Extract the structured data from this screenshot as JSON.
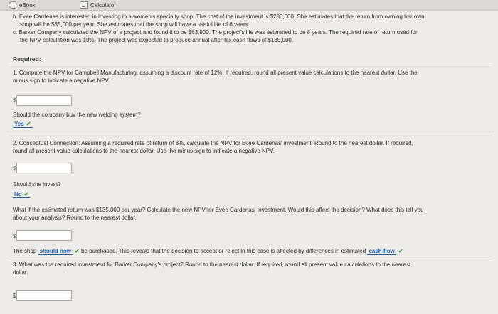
{
  "topbar": {
    "ebook_label": "eBook",
    "calculator_label": "Calculator"
  },
  "intro": {
    "b_line1": "b. Evee Cardenas is interested in investing in a women's specialty shop. The cost of the investment is $280,000. She estimates that the return from owning her own",
    "b_line2": "shop will be $35,000 per year. She estimates that the shop will have a useful life of 6 years.",
    "c_line1": "c. Barker Company calculated the NPV of a project and found it to be $63,900. The project's life was estimated to be 8 years. The required rate of return used for",
    "c_line2": "the NPV calculation was 10%. The project was expected to produce annual after-tax cash flows of $135,000."
  },
  "required": "Required:",
  "q1": {
    "line1": "1. Compute the NPV for Campbell Manufacturing, assuming a discount rate of 12%. If required, round all present value calculations to the nearest dollar. Use the",
    "line2": "minus sign to indicate a negative NPV.",
    "dollar": "$",
    "input_value": "",
    "question": "Should the company buy the new welding system?",
    "answer": "Yes",
    "check": "✔"
  },
  "q2": {
    "line1": "2. Conceptual Connection: Assuming a required rate of return of 8%, calculate the NPV for Evee Cardenas' investment. Round to the nearest dollar. If required,",
    "line2": "round all present value calculations to the nearest dollar. Use the minus sign to indicate a negative NPV.",
    "dollar": "$",
    "input_value": "",
    "question": "Should she invest?",
    "answer": "No",
    "check": "✔",
    "what_line1": "What if the estimated return was $135,000 per year? Calculate the new NPV for Evee Cardenas' investment. Would this affect the decision? What does this tell you",
    "what_line2": "about your analysis? Round to the nearest dollar.",
    "dollar2": "$",
    "input2_value": "",
    "sentence_pre": "The shop",
    "dd1": "should now",
    "sentence_mid": "be purchased. This reveals that the decision to accept or reject in this case is affected by differences in estimated",
    "dd2": "cash flow",
    "check2": "✔"
  },
  "q3": {
    "line1": "3. What was the required investment for Barker Company's project? Round to the nearest dollar. If required, round all present value calculations to the nearest",
    "line2": "dollar.",
    "dollar": "$",
    "input_value": ""
  }
}
